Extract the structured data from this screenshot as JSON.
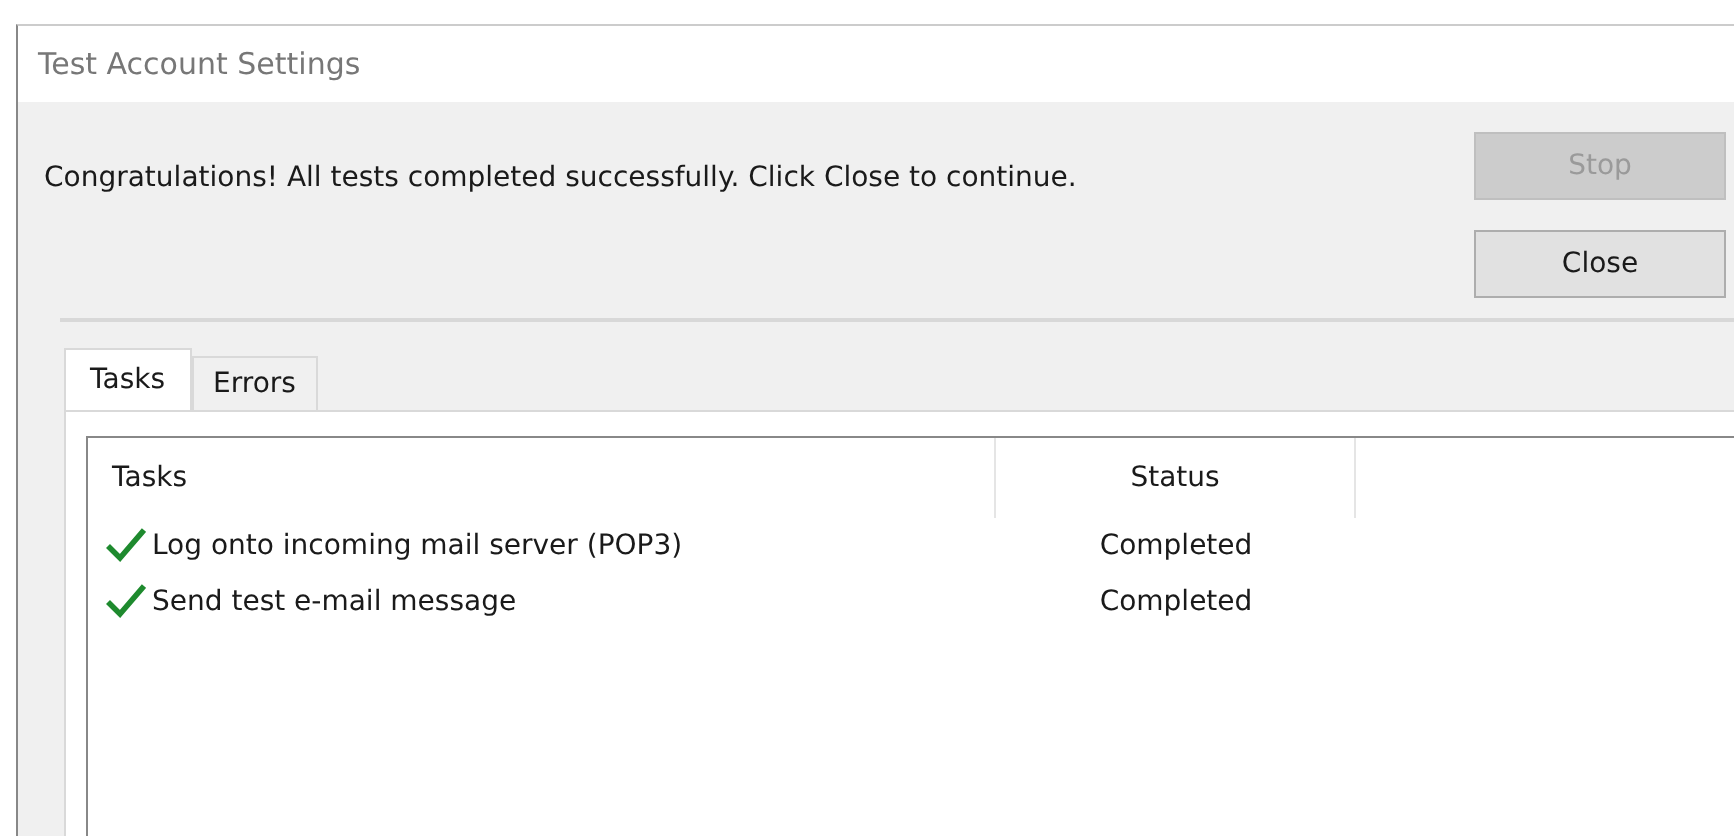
{
  "window": {
    "title": "Test Account Settings"
  },
  "message": "Congratulations! All tests completed successfully. Click Close to continue.",
  "buttons": [
    {
      "label": "Stop",
      "disabled": true
    },
    {
      "label": "Close",
      "disabled": false
    }
  ],
  "tabs": [
    {
      "label": "Tasks",
      "selected": true
    },
    {
      "label": "Errors",
      "selected": false
    }
  ],
  "table": {
    "columns": [
      "Tasks",
      "Status"
    ],
    "rows": [
      {
        "task": "Log onto incoming mail server (POP3)",
        "status": "Completed"
      },
      {
        "task": "Send test e-mail message",
        "status": "Completed"
      }
    ]
  }
}
